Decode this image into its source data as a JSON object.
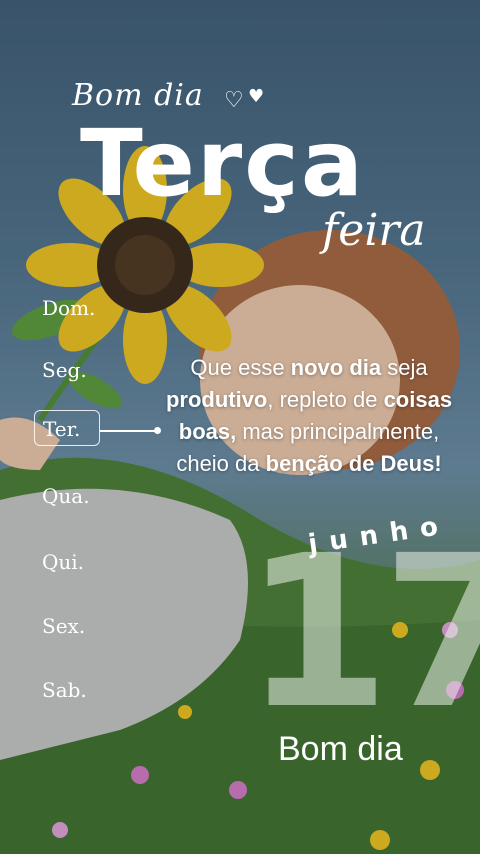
{
  "header": {
    "greeting": "Bom dia",
    "weekday": "Terça",
    "weekday_suffix": "feira",
    "heart_outline": "♡",
    "heart_filled": "♥"
  },
  "days": [
    {
      "label": "Dom.",
      "active": false
    },
    {
      "label": "Seg.",
      "active": false
    },
    {
      "label": "Ter.",
      "active": true
    },
    {
      "label": "Qua.",
      "active": false
    },
    {
      "label": "Qui.",
      "active": false
    },
    {
      "label": "Sex.",
      "active": false
    },
    {
      "label": "Sab.",
      "active": false
    }
  ],
  "message": {
    "part1": "Que esse ",
    "bold1": "novo dia",
    "part2": " seja ",
    "bold2": "produtivo",
    "part3": ", repleto de ",
    "bold3": "coisas boas,",
    "part4": " mas principalmente, cheio da ",
    "bold4": "benção de Deus!"
  },
  "date": {
    "month": "junho",
    "day": "17"
  },
  "footer": {
    "greeting": "Bom dia"
  },
  "colors": {
    "text": "#ffffff",
    "sky": "#4f6f86",
    "grass": "#3f6b2c",
    "sunflower": "#f2c318"
  },
  "icons": [
    "heart-outline-icon",
    "heart-filled-icon",
    "sunflower-illustration"
  ]
}
